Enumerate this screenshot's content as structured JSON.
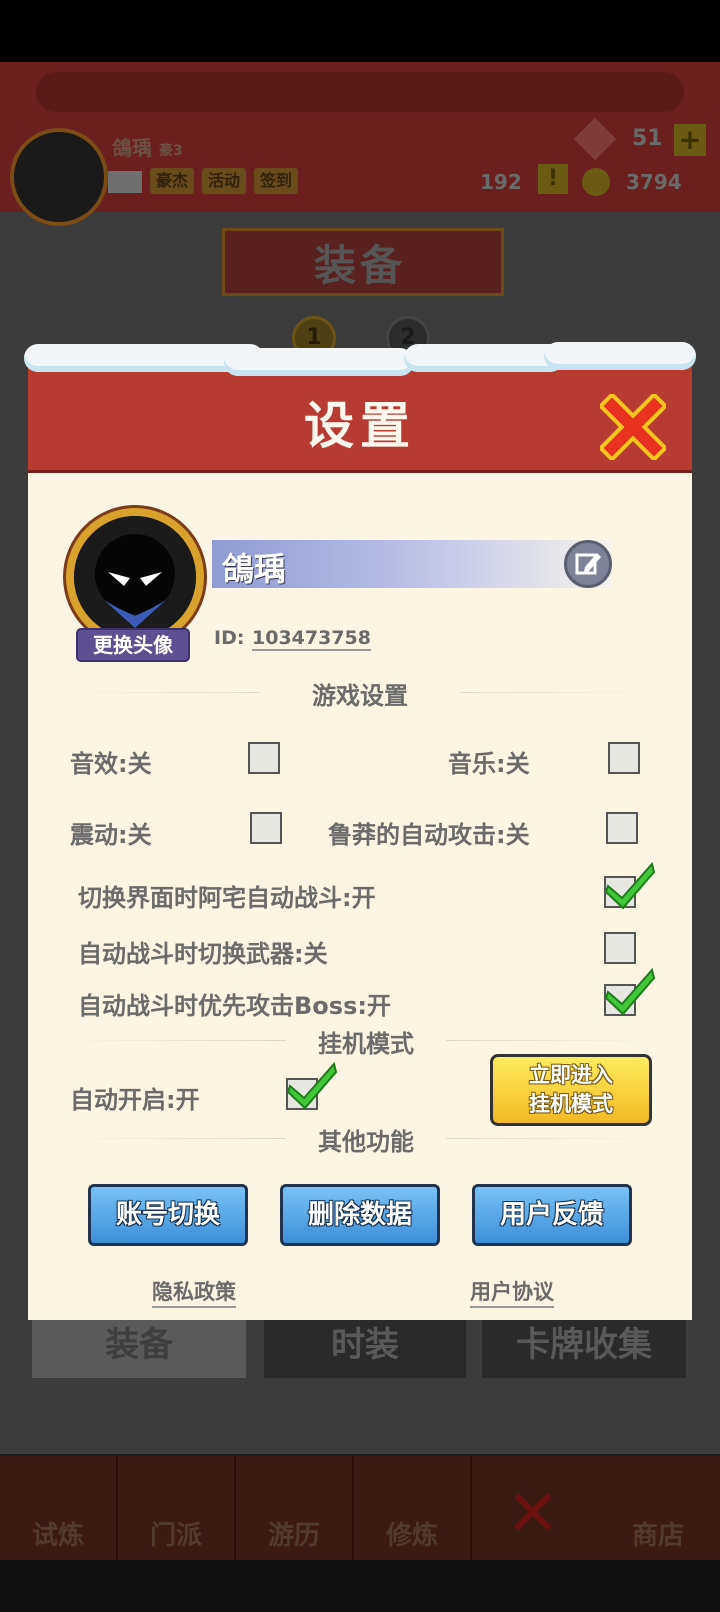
{
  "background": {
    "player_name": "鴿瑀",
    "vip_label": "豪3",
    "gems": "51",
    "plus": "+",
    "chips": [
      "豪杰",
      "活动",
      "签到"
    ],
    "coupons": "192",
    "alert": "!",
    "coins": "3794",
    "screen_title": "装备",
    "steps": [
      "1",
      "2"
    ],
    "tabs": [
      "装备",
      "时装",
      "卡牌收集"
    ],
    "nav": [
      "试炼",
      "门派",
      "游历",
      "修炼",
      "商店"
    ]
  },
  "dialog": {
    "title": "设置",
    "close_icon": "close-x-icon",
    "profile": {
      "name": "鴿瑀",
      "change_avatar": "更换头像",
      "id_label": "ID:",
      "id_value": "103473758"
    },
    "game_settings": {
      "title": "游戏设置",
      "options": {
        "sound": {
          "label": "音效:关",
          "checked": false
        },
        "music": {
          "label": "音乐:关",
          "checked": false
        },
        "vibration": {
          "label": "震动:关",
          "checked": false
        },
        "reckless_auto_attack": {
          "label": "鲁莽的自动攻击:关",
          "checked": false
        },
        "auto_battle_switch": {
          "label": "切换界面时阿宅自动战斗:开",
          "checked": true
        },
        "auto_switch_weapon": {
          "label": "自动战斗时切换武器:关",
          "checked": false
        },
        "prioritize_boss": {
          "label": "自动战斗时优先攻击Boss:开",
          "checked": true
        }
      }
    },
    "idle_mode": {
      "title": "挂机模式",
      "auto_start": {
        "label": "自动开启:开",
        "checked": true
      },
      "enter_button_line1": "立即进入",
      "enter_button_line2": "挂机模式"
    },
    "other": {
      "title": "其他功能",
      "buttons": [
        "账号切换",
        "删除数据",
        "用户反馈"
      ],
      "privacy": "隐私政策",
      "agreement": "用户协议"
    }
  },
  "colors": {
    "header_red": "#b83b32",
    "panel_cream": "#fdf5e4",
    "check_green": "#43c63a",
    "button_blue": "#3e8fd8",
    "button_yellow": "#f2b925"
  }
}
